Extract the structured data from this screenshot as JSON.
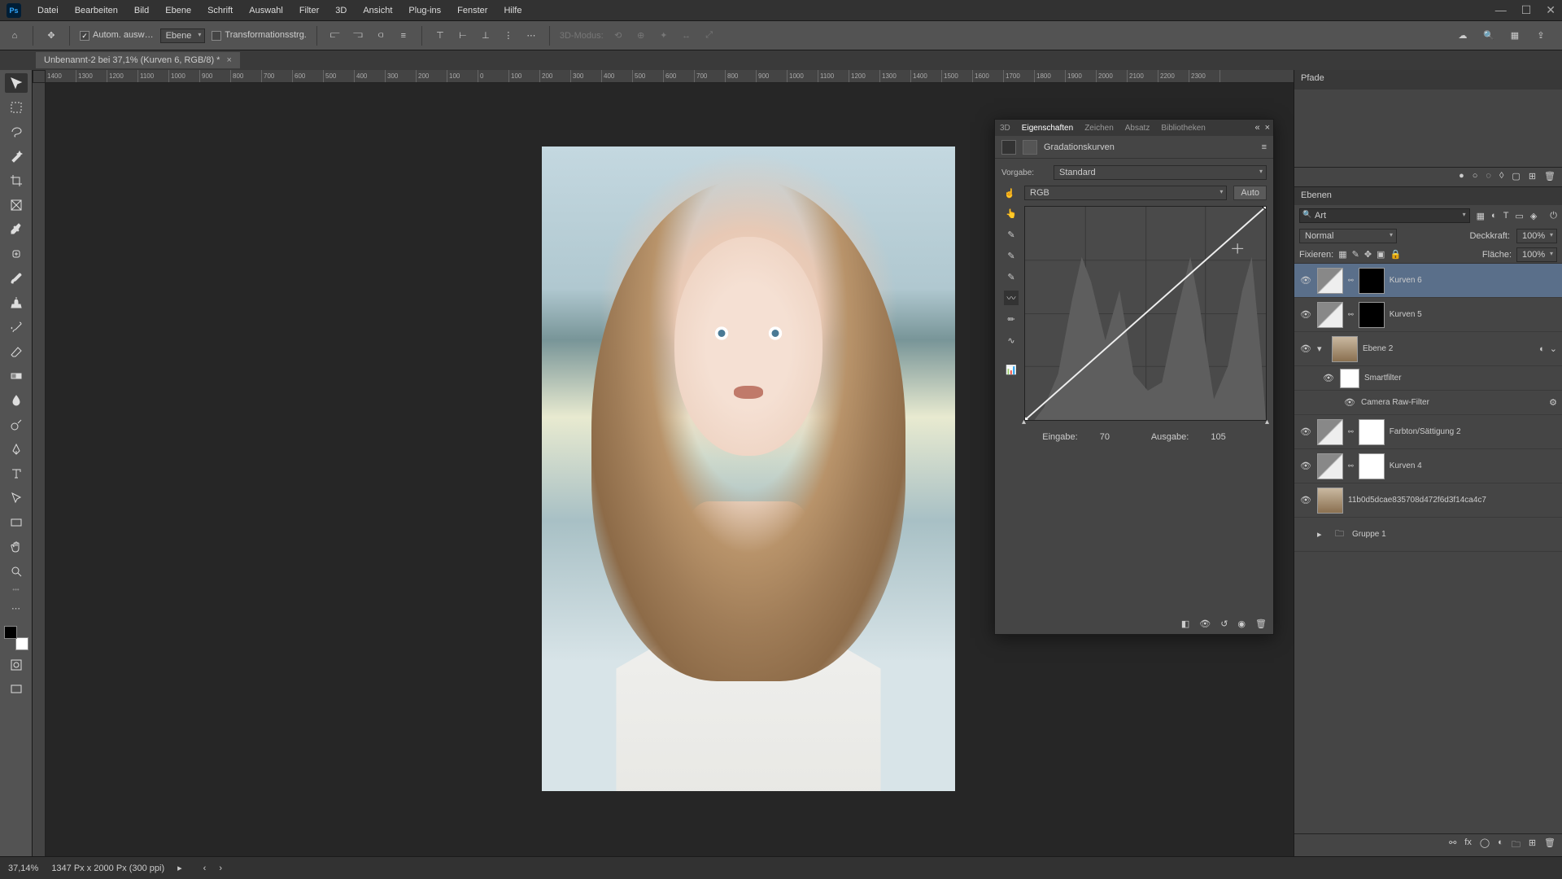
{
  "menu": {
    "items": [
      "Datei",
      "Bearbeiten",
      "Bild",
      "Ebene",
      "Schrift",
      "Auswahl",
      "Filter",
      "3D",
      "Ansicht",
      "Plug-ins",
      "Fenster",
      "Hilfe"
    ]
  },
  "optbar": {
    "auto_select": "Autom. ausw…",
    "layer_dd": "Ebene",
    "transform": "Transformationsstrg.",
    "mode_3d": "3D-Modus:"
  },
  "doc": {
    "tab": "Unbenannt-2 bei 37,1% (Kurven 6, RGB/8) *"
  },
  "ruler": {
    "ticks": [
      "1400",
      "1300",
      "1200",
      "1100",
      "1000",
      "900",
      "800",
      "700",
      "600",
      "500",
      "400",
      "300",
      "200",
      "100",
      "0",
      "100",
      "200",
      "300",
      "400",
      "500",
      "600",
      "700",
      "800",
      "900",
      "1000",
      "1100",
      "1200",
      "1300",
      "1400",
      "1500",
      "1600",
      "1700",
      "1800",
      "1900",
      "2000",
      "2100",
      "2200",
      "2300"
    ]
  },
  "props": {
    "tabs": [
      "3D",
      "Eigenschaften",
      "Zeichen",
      "Absatz",
      "Bibliotheken"
    ],
    "title": "Gradationskurven",
    "preset_label": "Vorgabe:",
    "preset": "Standard",
    "channel": "RGB",
    "auto": "Auto",
    "input_label": "Eingabe:",
    "input_val": "70",
    "output_label": "Ausgabe:",
    "output_val": "105"
  },
  "paths": {
    "title": "Pfade"
  },
  "layers": {
    "title": "Ebenen",
    "kind_dd": "Art",
    "blend": "Normal",
    "opacity_label": "Deckkraft:",
    "opacity": "100%",
    "lock_label": "Fixieren:",
    "fill_label": "Fläche:",
    "fill": "100%",
    "items": [
      {
        "name": "Kurven 6",
        "sel": true,
        "mask": "black",
        "adj": true
      },
      {
        "name": "Kurven 5",
        "mask": "black",
        "adj": true
      },
      {
        "name": "Ebene 2",
        "thumb": "img",
        "smart": true,
        "expand": true
      },
      {
        "name": "Smartfilter",
        "sub": true,
        "thumb": "white"
      },
      {
        "name": "Camera Raw-Filter",
        "sub": true,
        "subsub": true
      },
      {
        "name": "Farbton/Sättigung 2",
        "mask": "white",
        "adj": true
      },
      {
        "name": "Kurven 4",
        "mask": "white",
        "adj": true
      },
      {
        "name": "11b0d5dcae835708d472f6d3f14ca4c7",
        "thumb": "img"
      },
      {
        "name": "Gruppe 1",
        "folder": true,
        "hidden": true
      }
    ]
  },
  "status": {
    "zoom": "37,14%",
    "doc_info": "1347 Px x 2000 Px (300 ppi)"
  },
  "chart_data": {
    "type": "line",
    "title": "Gradationskurven (RGB)",
    "xlabel": "Eingabe",
    "ylabel": "Ausgabe",
    "xlim": [
      0,
      255
    ],
    "ylim": [
      0,
      255
    ],
    "series": [
      {
        "name": "RGB",
        "points": [
          [
            0,
            0
          ],
          [
            255,
            255
          ]
        ]
      }
    ],
    "active_point": {
      "input": 70,
      "output": 105
    },
    "histogram_peaks": [
      60,
      100,
      175,
      240
    ]
  }
}
